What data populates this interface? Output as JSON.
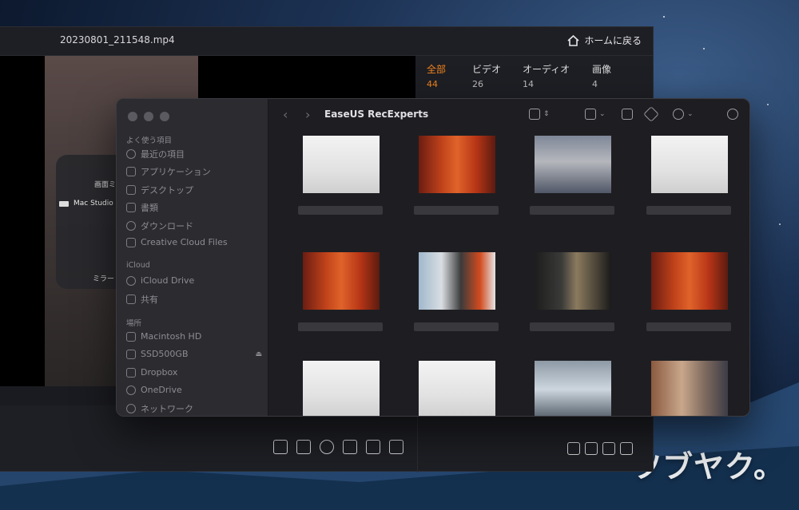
{
  "player": {
    "filename": "20230801_211548.mp4",
    "home_label": "ホームに戻る",
    "categories": [
      {
        "label": "全部",
        "count": "44",
        "active": true
      },
      {
        "label": "ビデオ",
        "count": "26",
        "active": false
      },
      {
        "label": "オーディオ",
        "count": "14",
        "active": false
      },
      {
        "label": "画像",
        "count": "4",
        "active": false
      }
    ],
    "overlay": {
      "title_partial": "画面ミ",
      "device": "Mac Studio",
      "bottom_partial": "ミラー"
    },
    "toolbar_icons": [
      "scissors-icon",
      "film-icon",
      "audio-icon",
      "snapshot-icon",
      "speaker-icon",
      "expand-icon"
    ],
    "right_icons": [
      "edit-icon",
      "sort-icon",
      "folder-icon",
      "trash-icon"
    ]
  },
  "finder": {
    "title": "EaseUS RecExperts",
    "sidebar": {
      "favorites_header": "よく使う項目",
      "favorites": [
        {
          "label": "最近の項目",
          "icon": "clock-icon"
        },
        {
          "label": "アプリケーション",
          "icon": "apps-icon"
        },
        {
          "label": "デスクトップ",
          "icon": "desktop-icon"
        },
        {
          "label": "書類",
          "icon": "document-icon"
        },
        {
          "label": "ダウンロード",
          "icon": "download-icon"
        },
        {
          "label": "Creative Cloud Files",
          "icon": "file-icon"
        }
      ],
      "icloud_header": "iCloud",
      "icloud": [
        {
          "label": "iCloud Drive",
          "icon": "cloud-icon"
        },
        {
          "label": "共有",
          "icon": "shared-folder-icon"
        }
      ],
      "locations_header": "場所",
      "locations": [
        {
          "label": "Macintosh HD",
          "icon": "disk-icon"
        },
        {
          "label": "SSD500GB",
          "icon": "disk-icon",
          "eject": true
        },
        {
          "label": "Dropbox",
          "icon": "dropbox-icon"
        },
        {
          "label": "OneDrive",
          "icon": "cloud-icon"
        },
        {
          "label": "ネットワーク",
          "icon": "network-icon"
        }
      ]
    },
    "thumbnails": [
      "white",
      "red",
      "gray",
      "white",
      "red",
      "mix",
      "dark",
      "red",
      "white",
      "white",
      "blue",
      "beige"
    ]
  },
  "watermark": "ツブヤク。"
}
